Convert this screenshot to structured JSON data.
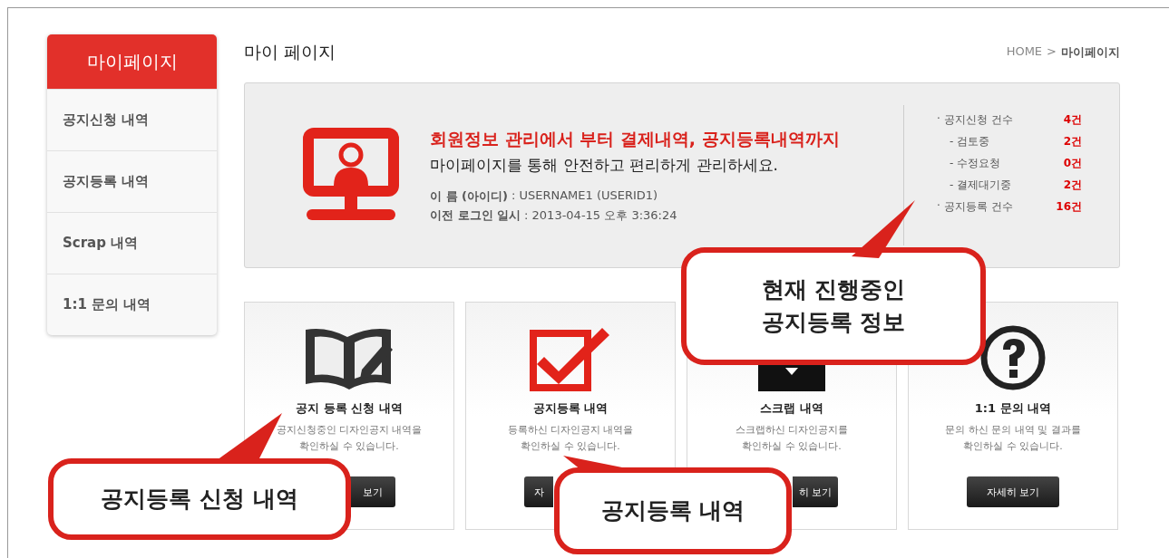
{
  "sidebar": {
    "title": "마이페이지",
    "items": [
      {
        "label": "공지신청 내역"
      },
      {
        "label": "공지등록 내역"
      },
      {
        "label": "Scrap 내역"
      },
      {
        "label": "1:1 문의 내역"
      }
    ]
  },
  "page_title": "마이 페이지",
  "breadcrumb": {
    "home": "HOME",
    "separator": ">",
    "current": "마이페이지"
  },
  "summary": {
    "headline": "회원정보 관리에서 부터 결제내역, 공지등록내역까지",
    "subline": "마이페이지를 통해 안전하고 편리하게 관리하세요.",
    "fields": [
      {
        "label": "이 름 (아이디)",
        "value": ": USERNAME1 (USERID1)"
      },
      {
        "label": "이전 로그인 일시",
        "value": ": 2013-04-15 오후 3:36:24"
      }
    ],
    "stats": [
      {
        "bullet": "·",
        "label": "공지신청 건수",
        "count": "4건",
        "children": [
          {
            "label": "- 검토중",
            "count": "2건"
          },
          {
            "label": "- 수정요청",
            "count": "0건"
          },
          {
            "label": "- 결제대기중",
            "count": "2건"
          }
        ]
      },
      {
        "bullet": "·",
        "label": "공지등록 건수",
        "count": "16건"
      }
    ]
  },
  "cards": [
    {
      "kind": "book",
      "title": "공지 등록 신청 내역",
      "lines": [
        "공지신청중인 디자인공지 내역을",
        "확인하실 수 있습니다."
      ],
      "button": "보기"
    },
    {
      "kind": "check",
      "title": "공지등록 내역",
      "lines": [
        "등록하신 디자인공지 내역을",
        "확인하실 수 있습니다."
      ],
      "button": "자"
    },
    {
      "kind": "scrap",
      "title": "스크랩 내역",
      "lines": [
        "스크랩하신 디자인공지를",
        "확인하실 수 있습니다."
      ],
      "button": "히 보기"
    },
    {
      "kind": "question",
      "title": "1:1 문의 내역",
      "lines": [
        "문의 하신 문의 내역 및 결과를",
        "확인하실 수 있습니다."
      ],
      "button": "자세히 보기"
    }
  ],
  "callouts": [
    {
      "lines": [
        "현재 진행중인",
        "공지등록 정보"
      ]
    },
    {
      "lines": [
        "공지등록 신청 내역"
      ]
    },
    {
      "lines": [
        "공지등록 내역"
      ]
    }
  ]
}
